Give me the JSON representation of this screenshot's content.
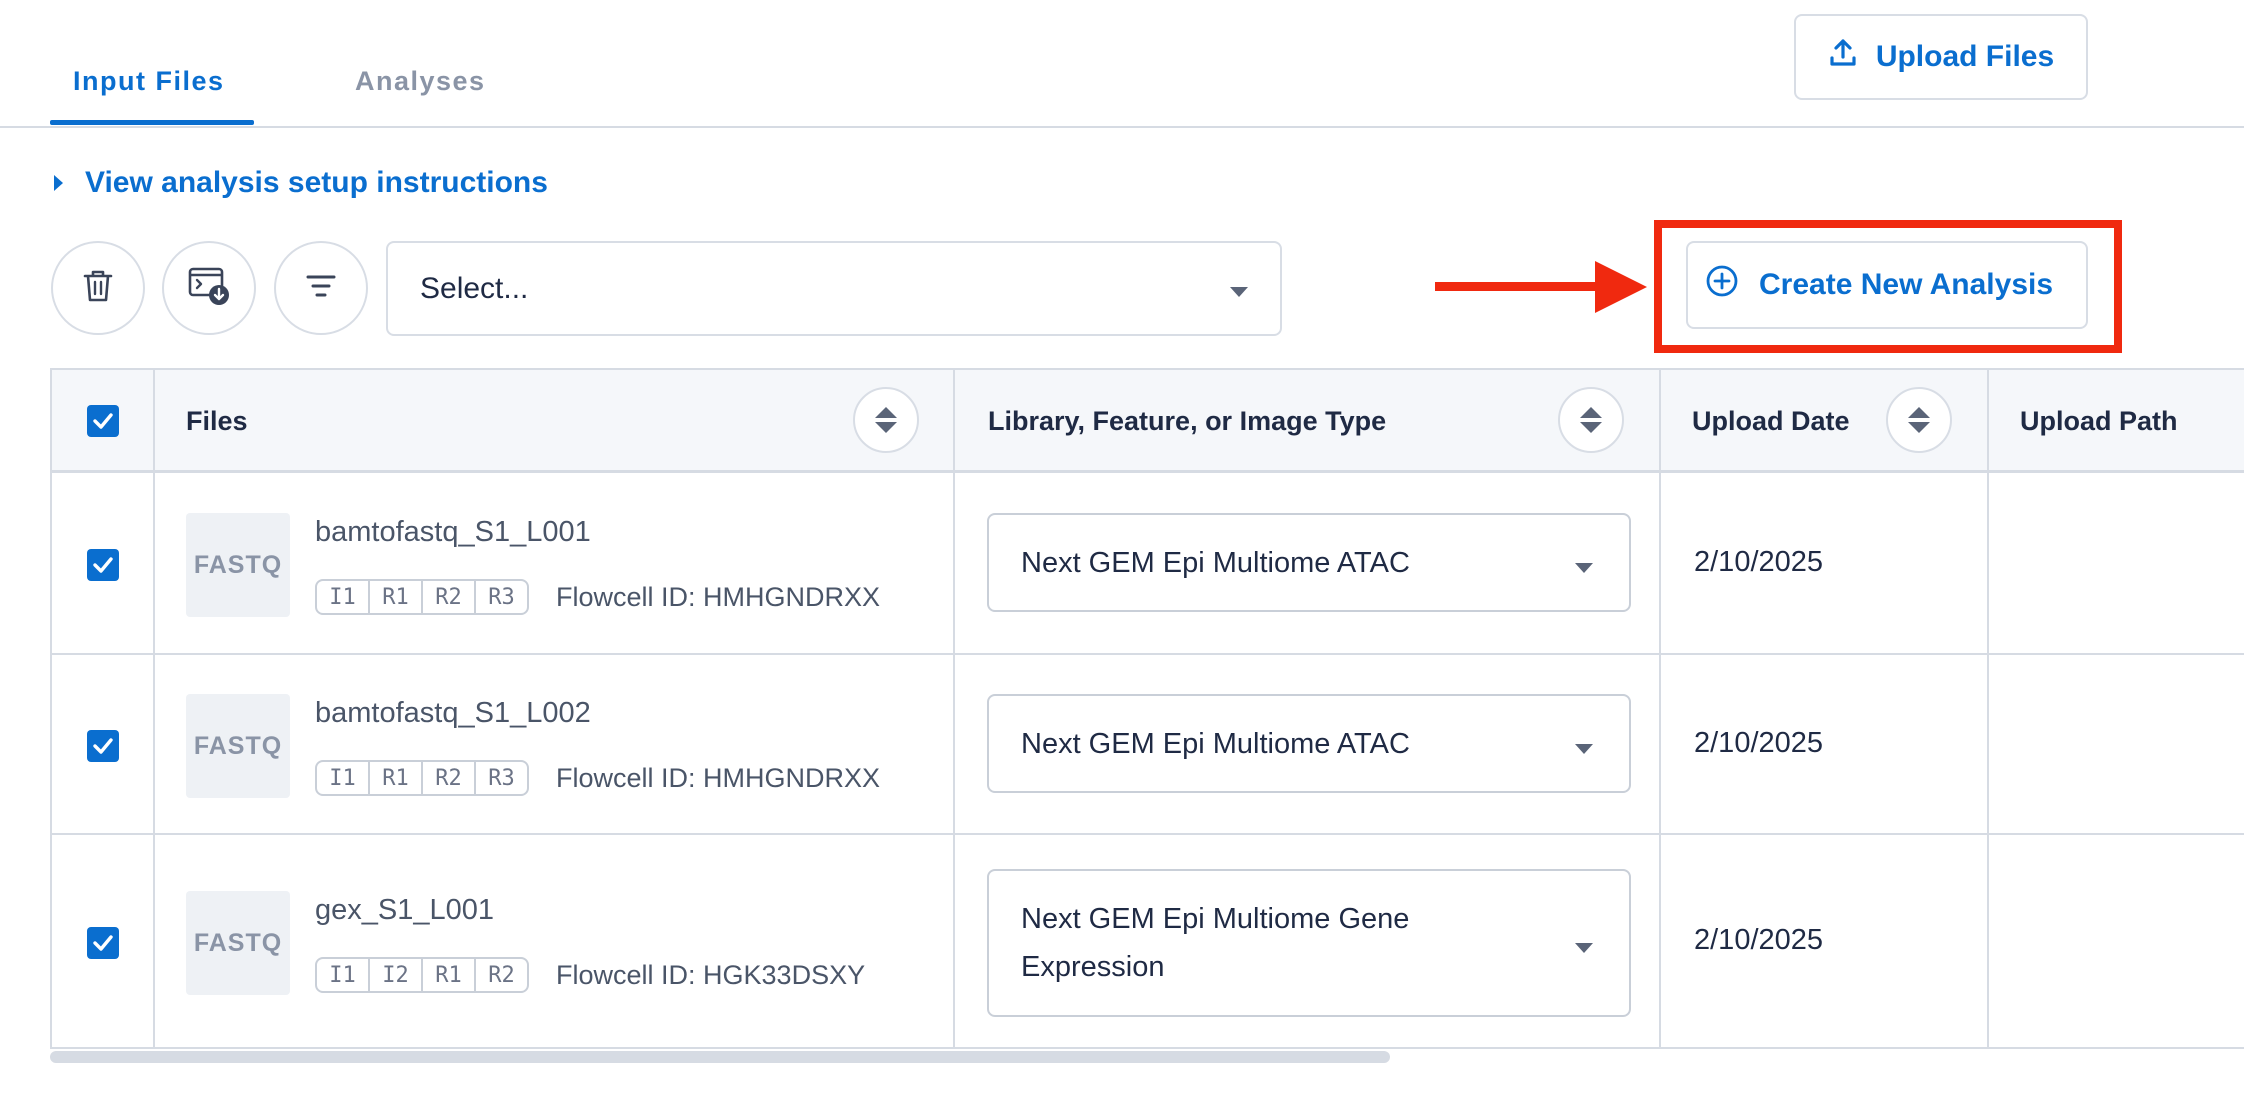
{
  "tabs": [
    {
      "label": "Input Files",
      "active": true
    },
    {
      "label": "Analyses",
      "active": false
    }
  ],
  "upload_button": {
    "label": "Upload Files",
    "icon": "upload-icon"
  },
  "instructions_link": {
    "label": "View analysis setup instructions"
  },
  "toolbar": {
    "delete_icon": "trash-icon",
    "download_icon": "terminal-download-icon",
    "filter_icon": "filter-icon",
    "select_value": "Select..."
  },
  "create_button": {
    "label": "Create New Analysis",
    "icon": "plus-circle-icon"
  },
  "annotation": {
    "color": "#f0290f"
  },
  "table": {
    "headers": {
      "files": "Files",
      "library": "Library, Feature, or Image Type",
      "upload_date": "Upload Date",
      "upload_path": "Upload Path"
    },
    "rows": [
      {
        "selected": true,
        "thumb": "FASTQ",
        "name": "bamtofastq_S1_L001",
        "reads": [
          "I1",
          "R1",
          "R2",
          "R3"
        ],
        "flowcell": "Flowcell ID: HMHGNDRXX",
        "library_line1": "Next GEM Epi Multiome ATAC",
        "library_line2": "",
        "date": "2/10/2025"
      },
      {
        "selected": true,
        "thumb": "FASTQ",
        "name": "bamtofastq_S1_L002",
        "reads": [
          "I1",
          "R1",
          "R2",
          "R3"
        ],
        "flowcell": "Flowcell ID: HMHGNDRXX",
        "library_line1": "Next GEM Epi Multiome ATAC",
        "library_line2": "",
        "date": "2/10/2025"
      },
      {
        "selected": true,
        "thumb": "FASTQ",
        "name": "gex_S1_L001",
        "reads": [
          "I1",
          "I2",
          "R1",
          "R2"
        ],
        "flowcell": "Flowcell ID: HGK33DSXY",
        "library_line1": "Next GEM Epi Multiome Gene",
        "library_line2": "Expression",
        "date": "2/10/2025"
      }
    ]
  },
  "colors": {
    "accent": "#0a6ecf",
    "border": "#d6dbe3",
    "header_bg": "#f5f7fa"
  }
}
